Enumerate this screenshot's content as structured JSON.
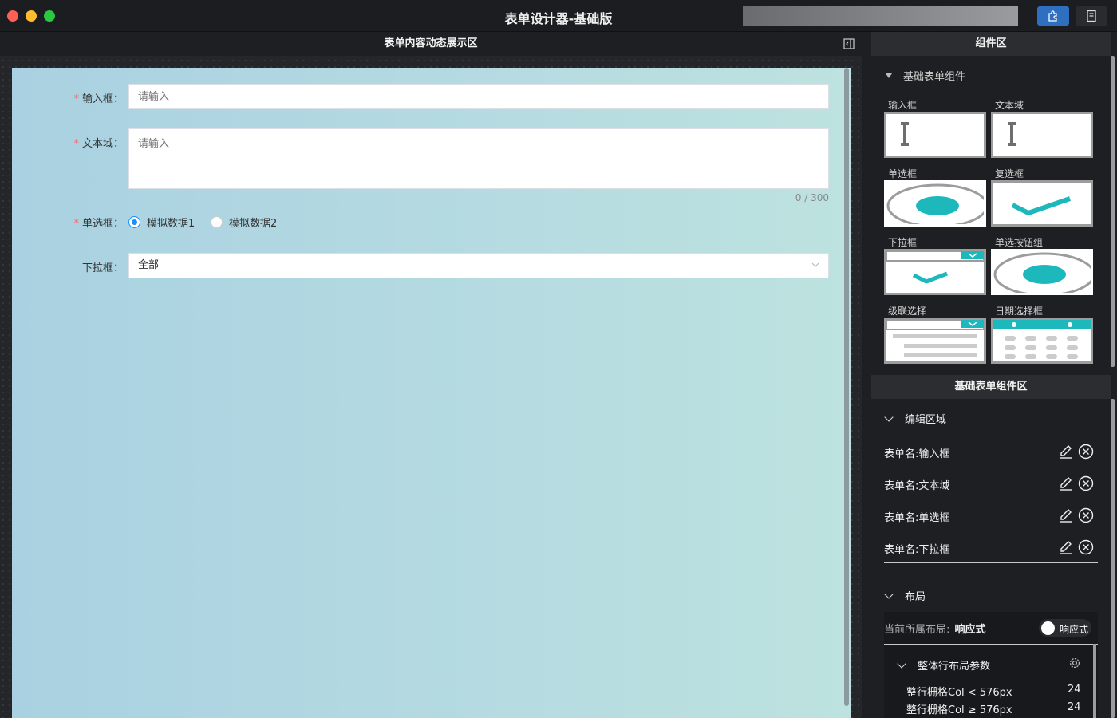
{
  "window": {
    "title": "表单设计器-基础版"
  },
  "left": {
    "header": "表单内容动态展示区",
    "form": {
      "input": {
        "label": "输入框：",
        "placeholder": "请输入",
        "required": true
      },
      "textarea": {
        "label": "文本域：",
        "placeholder": "请输入",
        "count": "0 / 300",
        "required": true
      },
      "radio": {
        "label": "单选框：",
        "required": true,
        "options": [
          "模拟数据1",
          "模拟数据2"
        ],
        "selected": "模拟数据1"
      },
      "select": {
        "label": "下拉框：",
        "value": "全部",
        "required": false
      }
    }
  },
  "components": {
    "header": "组件区",
    "section_title": "基础表单组件",
    "items": [
      "输入框",
      "文本域",
      "单选框",
      "复选框",
      "下拉框",
      "单选按钮组",
      "级联选择",
      "日期选择框"
    ]
  },
  "editor": {
    "header": "基础表单组件区",
    "edit_section": "编辑区域",
    "rows": [
      "表单名:输入框",
      "表单名:文本域",
      "表单名:单选框",
      "表单名:下拉框"
    ],
    "layout_section": "布局",
    "current_layout_label": "当前所属布局:",
    "current_layout_value": "响应式",
    "toggle_label": "响应式",
    "row_params_title": "整体行布局参数",
    "params": [
      {
        "label": "整行栅格Col < 576px",
        "value": "24"
      },
      {
        "label": "整行栅格Col ≥ 576px",
        "value": "24"
      }
    ]
  },
  "colors": {
    "accent_teal": "#1cb8bc",
    "primary_blue": "#2f6fbf",
    "radio_blue": "#1890ff",
    "required_red": "#f56c6c"
  },
  "icons": {
    "toolbar": [
      "puzzle-icon",
      "document-icon"
    ],
    "panel": "collapse-panel-icon",
    "row_actions": [
      "edit-pencil-icon",
      "delete-circle-icon"
    ],
    "settings": "gear-icon"
  }
}
